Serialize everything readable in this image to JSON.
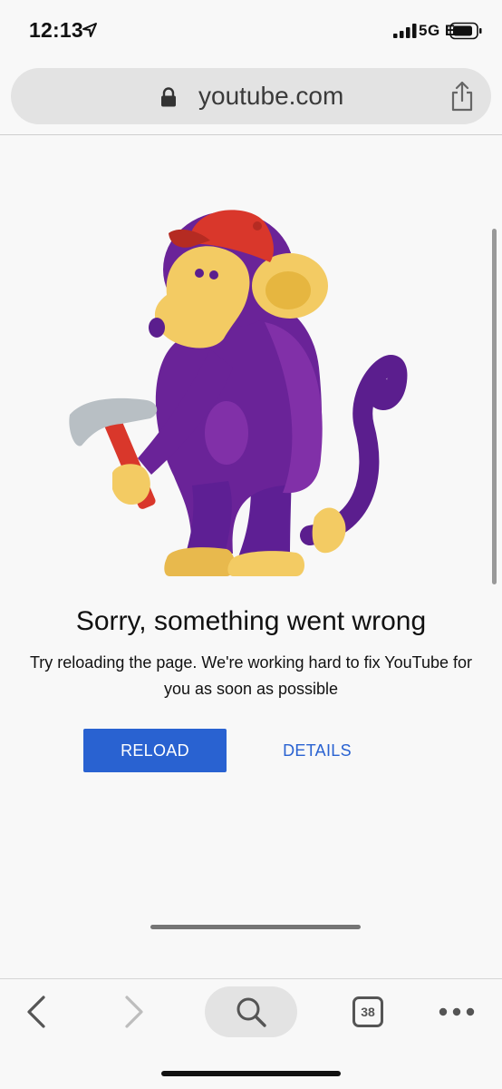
{
  "status_bar": {
    "time": "12:13",
    "network": "5G E",
    "icons": [
      "location-arrow-icon",
      "signal-bars-icon",
      "battery-icon"
    ]
  },
  "address_bar": {
    "url": "youtube.com",
    "icons": [
      "lock-icon",
      "share-icon"
    ]
  },
  "error": {
    "title": "Sorry, something went wrong",
    "message": "Try reloading the page. We're working hard to fix YouTube for you as soon as possible",
    "reload_label": "RELOAD",
    "details_label": "DETAILS",
    "illustration": "monkey-with-hammer-illustration"
  },
  "toolbar": {
    "tab_count": "38",
    "icons": [
      "back-arrow-icon",
      "forward-arrow-icon",
      "search-icon",
      "tabs-icon",
      "more-icon"
    ]
  },
  "colors": {
    "accent": "#2962d1",
    "background": "#f8f8f8",
    "monkey_purple": "#6a2398",
    "monkey_yellow": "#f3cb63",
    "cap_red": "#d9372b"
  }
}
